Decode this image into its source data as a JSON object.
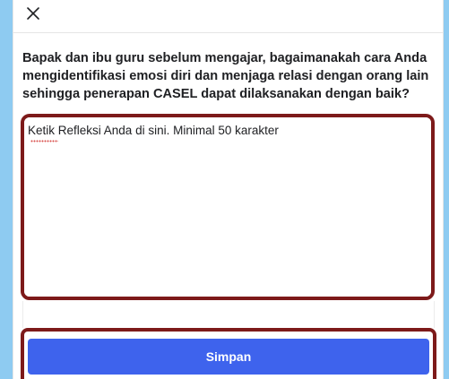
{
  "header": {
    "close_icon": "close-icon"
  },
  "question": {
    "text": "Bapak dan ibu guru sebelum mengajar, bagaimanakah cara Anda mengidentifikasi emosi diri dan menjaga relasi dengan orang lain sehingga penerapan CASEL dapat dilaksanakan dengan baik?"
  },
  "reflection": {
    "placeholder": "Ketik Refleksi Anda di sini. Minimal 50 karakter",
    "value": ""
  },
  "actions": {
    "save_label": "Simpan"
  },
  "colors": {
    "background": "#8ecbf1",
    "highlight_border": "#7d1a1a",
    "primary_button": "#3e63ed"
  }
}
